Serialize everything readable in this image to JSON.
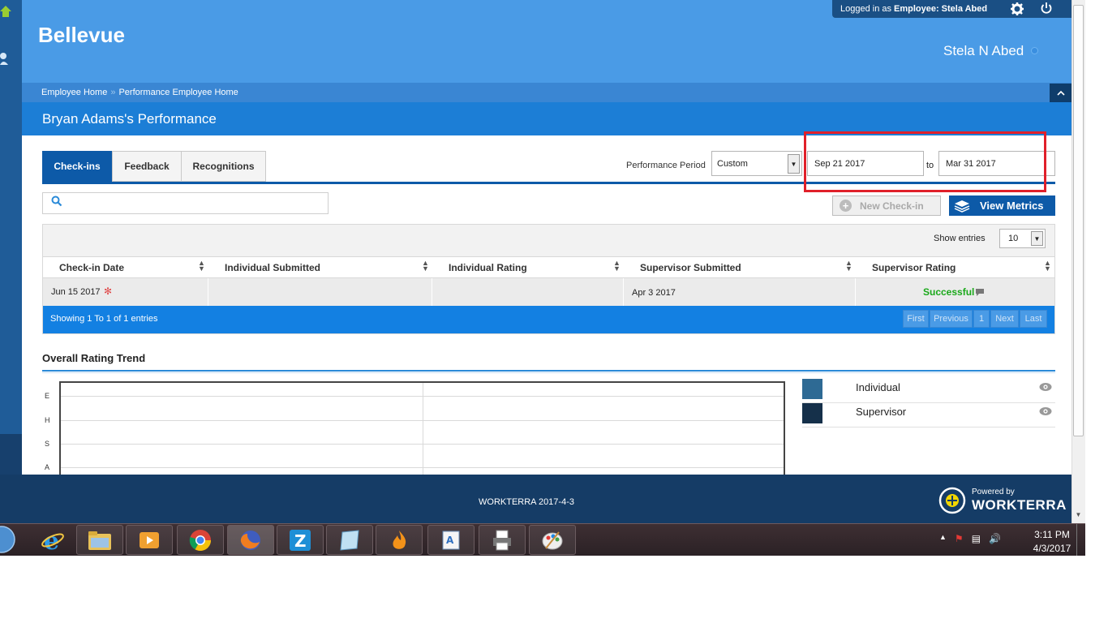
{
  "app": {
    "brand": "Bellevue",
    "login_prefix": "Logged in as",
    "login_role": "Employee:",
    "login_user": "Stela Abed",
    "user_display_name": "Stela N Abed"
  },
  "breadcrumb": {
    "items": [
      "Employee Home",
      "Performance Employee Home"
    ],
    "separator": "»"
  },
  "page_title": "Bryan Adams's Performance",
  "tabs": [
    {
      "label": "Check-ins",
      "active": true
    },
    {
      "label": "Feedback",
      "active": false
    },
    {
      "label": "Recognitions",
      "active": false
    }
  ],
  "period": {
    "label": "Performance Period",
    "selected": "Custom",
    "from": "Sep 21 2017",
    "to_label": "to",
    "to": "Mar 31 2017"
  },
  "search": {
    "placeholder": ""
  },
  "actions": {
    "new_checkin": "New Check-in",
    "view_metrics": "View Metrics"
  },
  "table": {
    "show_entries_label": "Show entries",
    "entries_value": "10",
    "columns": [
      "Check-in Date",
      "Individual Submitted",
      "Individual Rating",
      "Supervisor Submitted",
      "Supervisor Rating"
    ],
    "rows": [
      {
        "checkin_date": "Jun 15 2017",
        "individual_submitted": "",
        "individual_rating": "",
        "supervisor_submitted": "Apr 3 2017",
        "supervisor_rating": "Successful"
      }
    ],
    "showing": "Showing 1 To 1 of 1 entries",
    "pagination": [
      "First",
      "Previous",
      "1",
      "Next",
      "Last"
    ]
  },
  "trend": {
    "title": "Overall Rating Trend",
    "y_ticks": [
      "E",
      "H",
      "S",
      "A"
    ],
    "legend": [
      {
        "label": "Individual",
        "color": "#2e6a94"
      },
      {
        "label": "Supervisor",
        "color": "#15304a"
      }
    ]
  },
  "footer": {
    "text": "WORKTERRA 2017-4-3",
    "powered_small": "Powered by",
    "powered_big": "WORKTERRA"
  },
  "taskbar": {
    "time": "3:11 PM",
    "date": "4/3/2017"
  },
  "colors": {
    "header": "#4a9be6",
    "accent": "#0d5aa8",
    "success": "#1aa81a",
    "highlight": "#e0202a"
  }
}
